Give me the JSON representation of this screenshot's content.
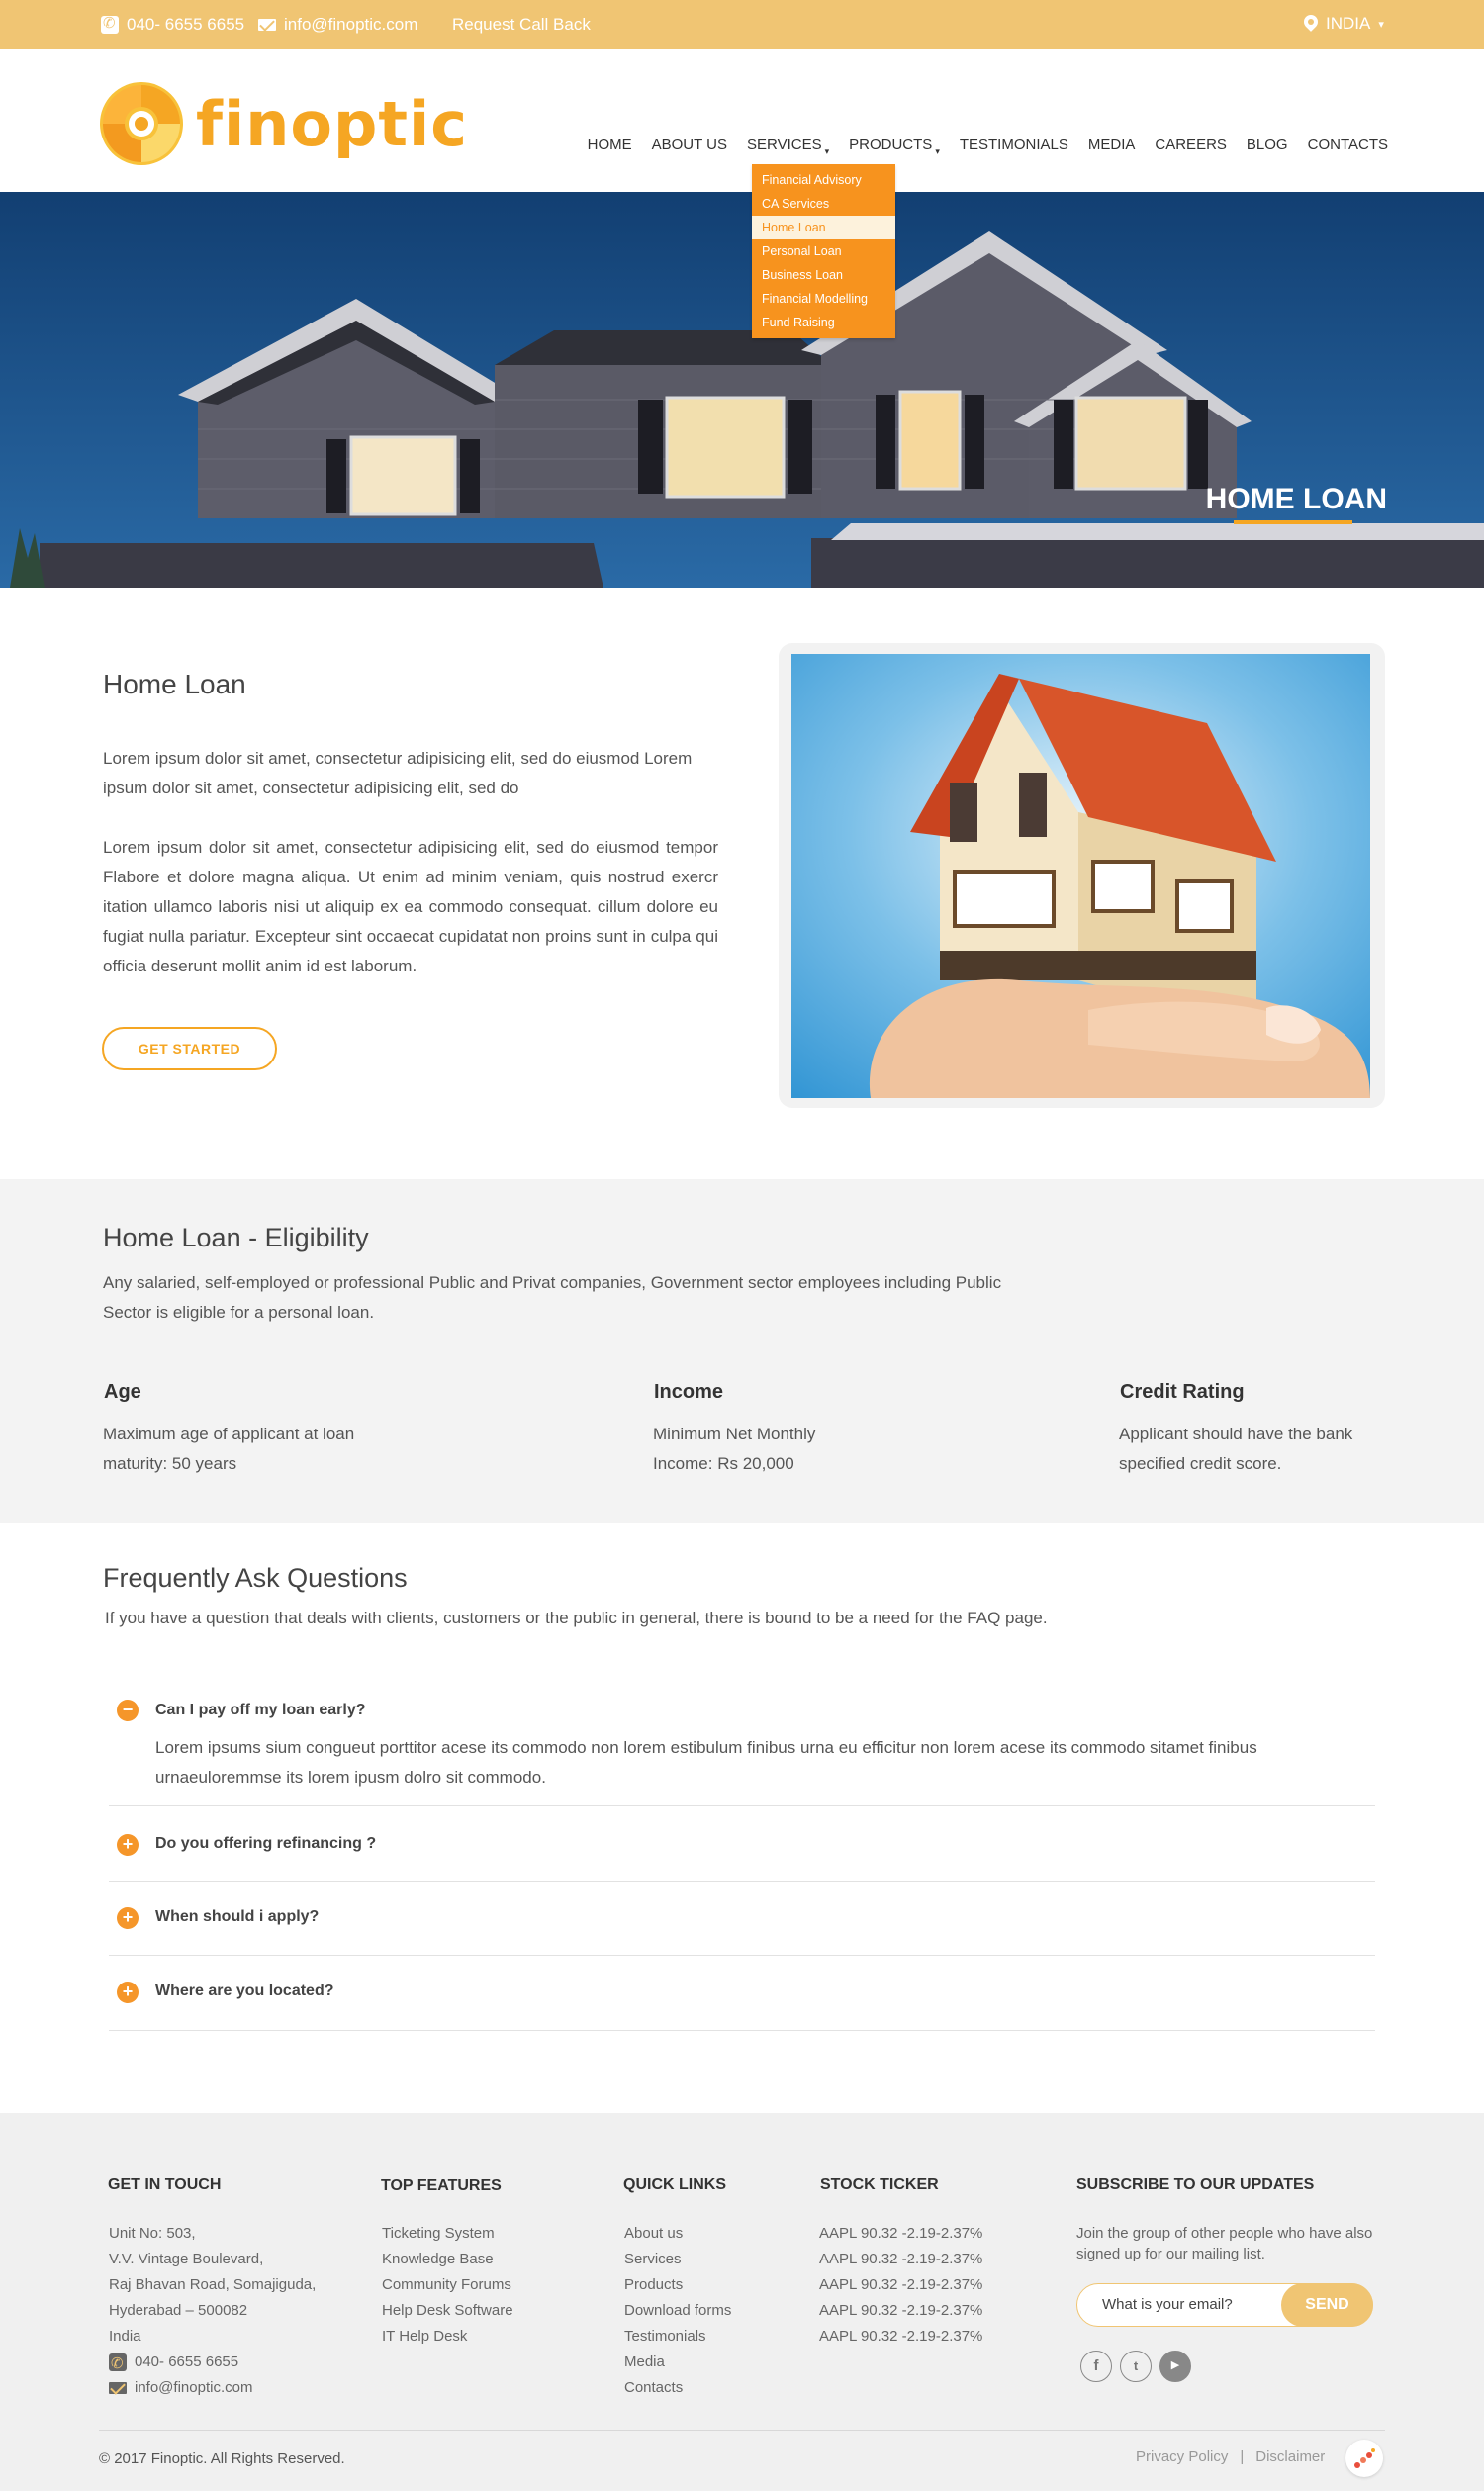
{
  "topbar": {
    "phone": "040- 6655 6655",
    "email": "info@finoptic.com",
    "callback": "Request Call Back",
    "country": "INDIA",
    "country_caret": "▾"
  },
  "logo": {
    "text": "finoptic"
  },
  "nav": {
    "items": [
      "HOME",
      "ABOUT US",
      "SERVICES",
      "PRODUCTS",
      "TESTIMONIALS",
      "MEDIA",
      "CAREERS",
      "BLOG",
      "CONTACTS"
    ],
    "caret": "▾"
  },
  "services_menu": [
    "Financial Advisory",
    "CA Services",
    "Home Loan",
    "Personal Loan",
    "Business Loan",
    "Financial Modelling",
    "Fund Raising"
  ],
  "hero": {
    "title": "HOME LOAN"
  },
  "intro": {
    "title": "Home Loan",
    "p1": "Lorem ipsum dolor sit amet, consectetur adipisicing elit,  sed do  eiusmod  Lorem ipsum dolor sit amet, consectetur adipisicing elit, sed do",
    "p2": "Lorem ipsum dolor sit amet, consectetur adipisicing elit, sed do eiusmod  tempor Flabore et dolore magna aliqua. Ut enim  ad  minim  veniam, quis  nostrud  exercr itation ullamco laboris nisi ut aliquip ex ea commodo consequat. cillum dolore eu fugiat nulla pariatur. Excepteur sint  occaecat  cupidatat  non  proins sunt in culpa qui officia deserunt mollit anim id est laborum.",
    "button": "GET STARTED"
  },
  "eligibility": {
    "title": "Home Loan - Eligibility",
    "desc": "Any salaried, self-employed or professional Public and Privat companies, Government sector employees including Public Sector is eligible for a personal loan.",
    "cols": [
      {
        "title": "Age",
        "text": "Maximum age of applicant at loan maturity: 50 years"
      },
      {
        "title": "Income",
        "text": "Minimum Net Monthly Income: Rs 20,000"
      },
      {
        "title": "Credit Rating",
        "text": "Applicant should have the bank specified credit score."
      }
    ]
  },
  "faq": {
    "title": "Frequently Ask Questions",
    "desc": "If you have a question that deals with clients, customers or the public in general, there is bound to be a need for the FAQ page.",
    "items": [
      {
        "q": "Can I pay off my loan early?",
        "icon": "−",
        "a": "Lorem ipsums sium congueut porttitor acese its commodo non lorem estibulum finibus urna eu efficitur non lorem acese its commodo sitamet finibus urnaeuloremmse its lorem ipusm dolro sit commodo."
      },
      {
        "q": "Do you offering refinancing ?",
        "icon": "+"
      },
      {
        "q": "When should i apply?",
        "icon": "+"
      },
      {
        "q": "Where are you located?",
        "icon": "+"
      }
    ]
  },
  "footer": {
    "touch": {
      "title": "GET IN TOUCH",
      "lines": [
        "Unit No: 503,",
        "V.V. Vintage Boulevard,",
        "Raj Bhavan Road, Somajiguda,",
        "Hyderabad – 500082",
        "India"
      ],
      "phone": "040- 6655 6655",
      "email": "info@finoptic.com"
    },
    "features": {
      "title": "TOP FEATURES",
      "items": [
        "Ticketing System",
        "Knowledge Base",
        "Community Forums",
        "Help Desk Software",
        "IT Help Desk"
      ]
    },
    "links": {
      "title": "QUICK LINKS",
      "items": [
        "About us",
        "Services",
        "Products",
        "Download forms",
        "Testimonials",
        "Media",
        "Contacts"
      ]
    },
    "ticker": {
      "title": "STOCK TICKER",
      "items": [
        "AAPL 90.32 -2.19-2.37%",
        "AAPL 90.32 -2.19-2.37%",
        "AAPL 90.32 -2.19-2.37%",
        "AAPL 90.32 -2.19-2.37%",
        "AAPL 90.32 -2.19-2.37%"
      ]
    },
    "subscribe": {
      "title": "SUBSCRIBE TO OUR UPDATES",
      "text": "Join the group of other people who have also signed up for our mailing list.",
      "placeholder": "What is your email?",
      "button": "SEND"
    },
    "social": [
      {
        "icon": "facebook-icon",
        "glyph": "f"
      },
      {
        "icon": "twitter-icon",
        "glyph": "t"
      },
      {
        "icon": "youtube-icon",
        "glyph": "▶"
      }
    ],
    "copyright": "© 2017 Finoptic. All Rights Reserved.",
    "privacy": "Privacy Policy",
    "separator": "|",
    "disclaimer": "Disclaimer"
  },
  "colors": {
    "accent": "#f5a623",
    "topbar": "#f0c573",
    "menu": "#f7931e"
  }
}
